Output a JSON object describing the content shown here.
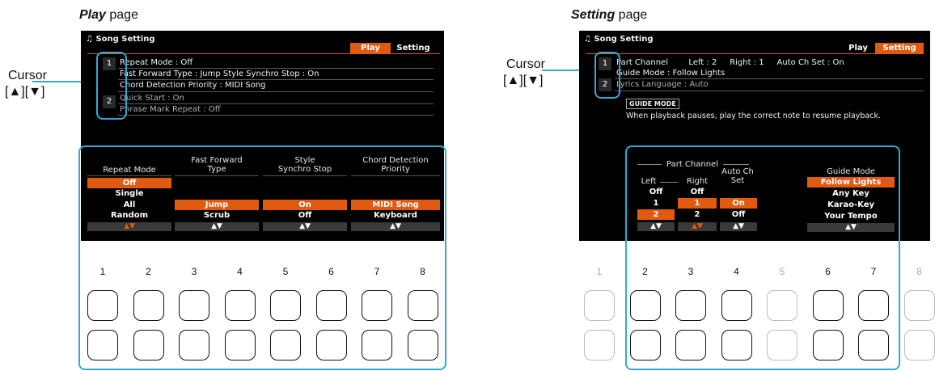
{
  "play": {
    "caption_bold": "Play",
    "caption_rest": " page",
    "cursor_label": "Cursor",
    "cursor_keys": "[▲][▼]",
    "screen_title": "Song Setting",
    "tabs": [
      "Play",
      "Setting"
    ],
    "active_tab": "Play",
    "group_indices": [
      "1",
      "2"
    ],
    "rows": [
      "Repeat Mode : Off",
      "Fast Forward Type : Jump      Style Synchro Stop : On",
      "Chord Detection Priority : MIDI Song",
      "Quick Start : On",
      "Phrase Mark Repeat : Off"
    ],
    "columns": [
      {
        "header": "Repeat Mode",
        "options": [
          "Off",
          "Single",
          "All",
          "Random"
        ],
        "selected": "Off",
        "arrows": "▲▼"
      },
      {
        "header": "Fast Forward\nType",
        "options": [
          "",
          "",
          "Jump",
          "Scrub"
        ],
        "selected": "Jump",
        "arrows": "▲▼"
      },
      {
        "header": "Style\nSynchro Stop",
        "options": [
          "",
          "",
          "On",
          "Off"
        ],
        "selected": "On",
        "arrows": "▲▼"
      },
      {
        "header": "Chord Detection\nPriority",
        "options": [
          "",
          "",
          "MIDI Song",
          "Keyboard"
        ],
        "selected": "MIDI Song",
        "arrows": "▲▼"
      }
    ],
    "buttons": [
      "1",
      "2",
      "3",
      "4",
      "5",
      "6",
      "7",
      "8"
    ]
  },
  "setting": {
    "caption_bold": "Setting",
    "caption_rest": " page",
    "cursor_label": "Cursor",
    "cursor_keys": "[▲][▼]",
    "screen_title": "Song Setting",
    "tabs": [
      "Play",
      "Setting"
    ],
    "active_tab": "Setting",
    "group_indices": [
      "1",
      "2"
    ],
    "rows": [
      "Part Channel        Left : 2     Right : 1     Auto Ch Set : On",
      "Guide Mode : Follow Lights",
      "Lyrics Language : Auto"
    ],
    "chip": "GUIDE MODE",
    "description": "When playback pauses, play the correct note to resume playback.",
    "group_header": "Part Channel",
    "columns": [
      {
        "header": "Left",
        "options": [
          "Off",
          "1",
          "2"
        ],
        "selected": "2",
        "arrows": "▲▼"
      },
      {
        "header": "Right",
        "options": [
          "Off",
          "1",
          "2"
        ],
        "selected": "1",
        "arrows": "▲▼"
      },
      {
        "header": "Auto Ch\nSet",
        "options": [
          "",
          "On",
          "Off"
        ],
        "selected": "On",
        "arrows": "▲▼"
      },
      {
        "header": "Guide Mode",
        "options": [
          "Follow Lights",
          "Any Key",
          "Karao-Key",
          "Your Tempo"
        ],
        "selected": "Follow Lights",
        "arrows": "▲▼"
      }
    ],
    "buttons": [
      "1",
      "2",
      "3",
      "4",
      "5",
      "6",
      "7",
      "8"
    ],
    "dim_buttons": [
      "1",
      "5",
      "8"
    ]
  }
}
